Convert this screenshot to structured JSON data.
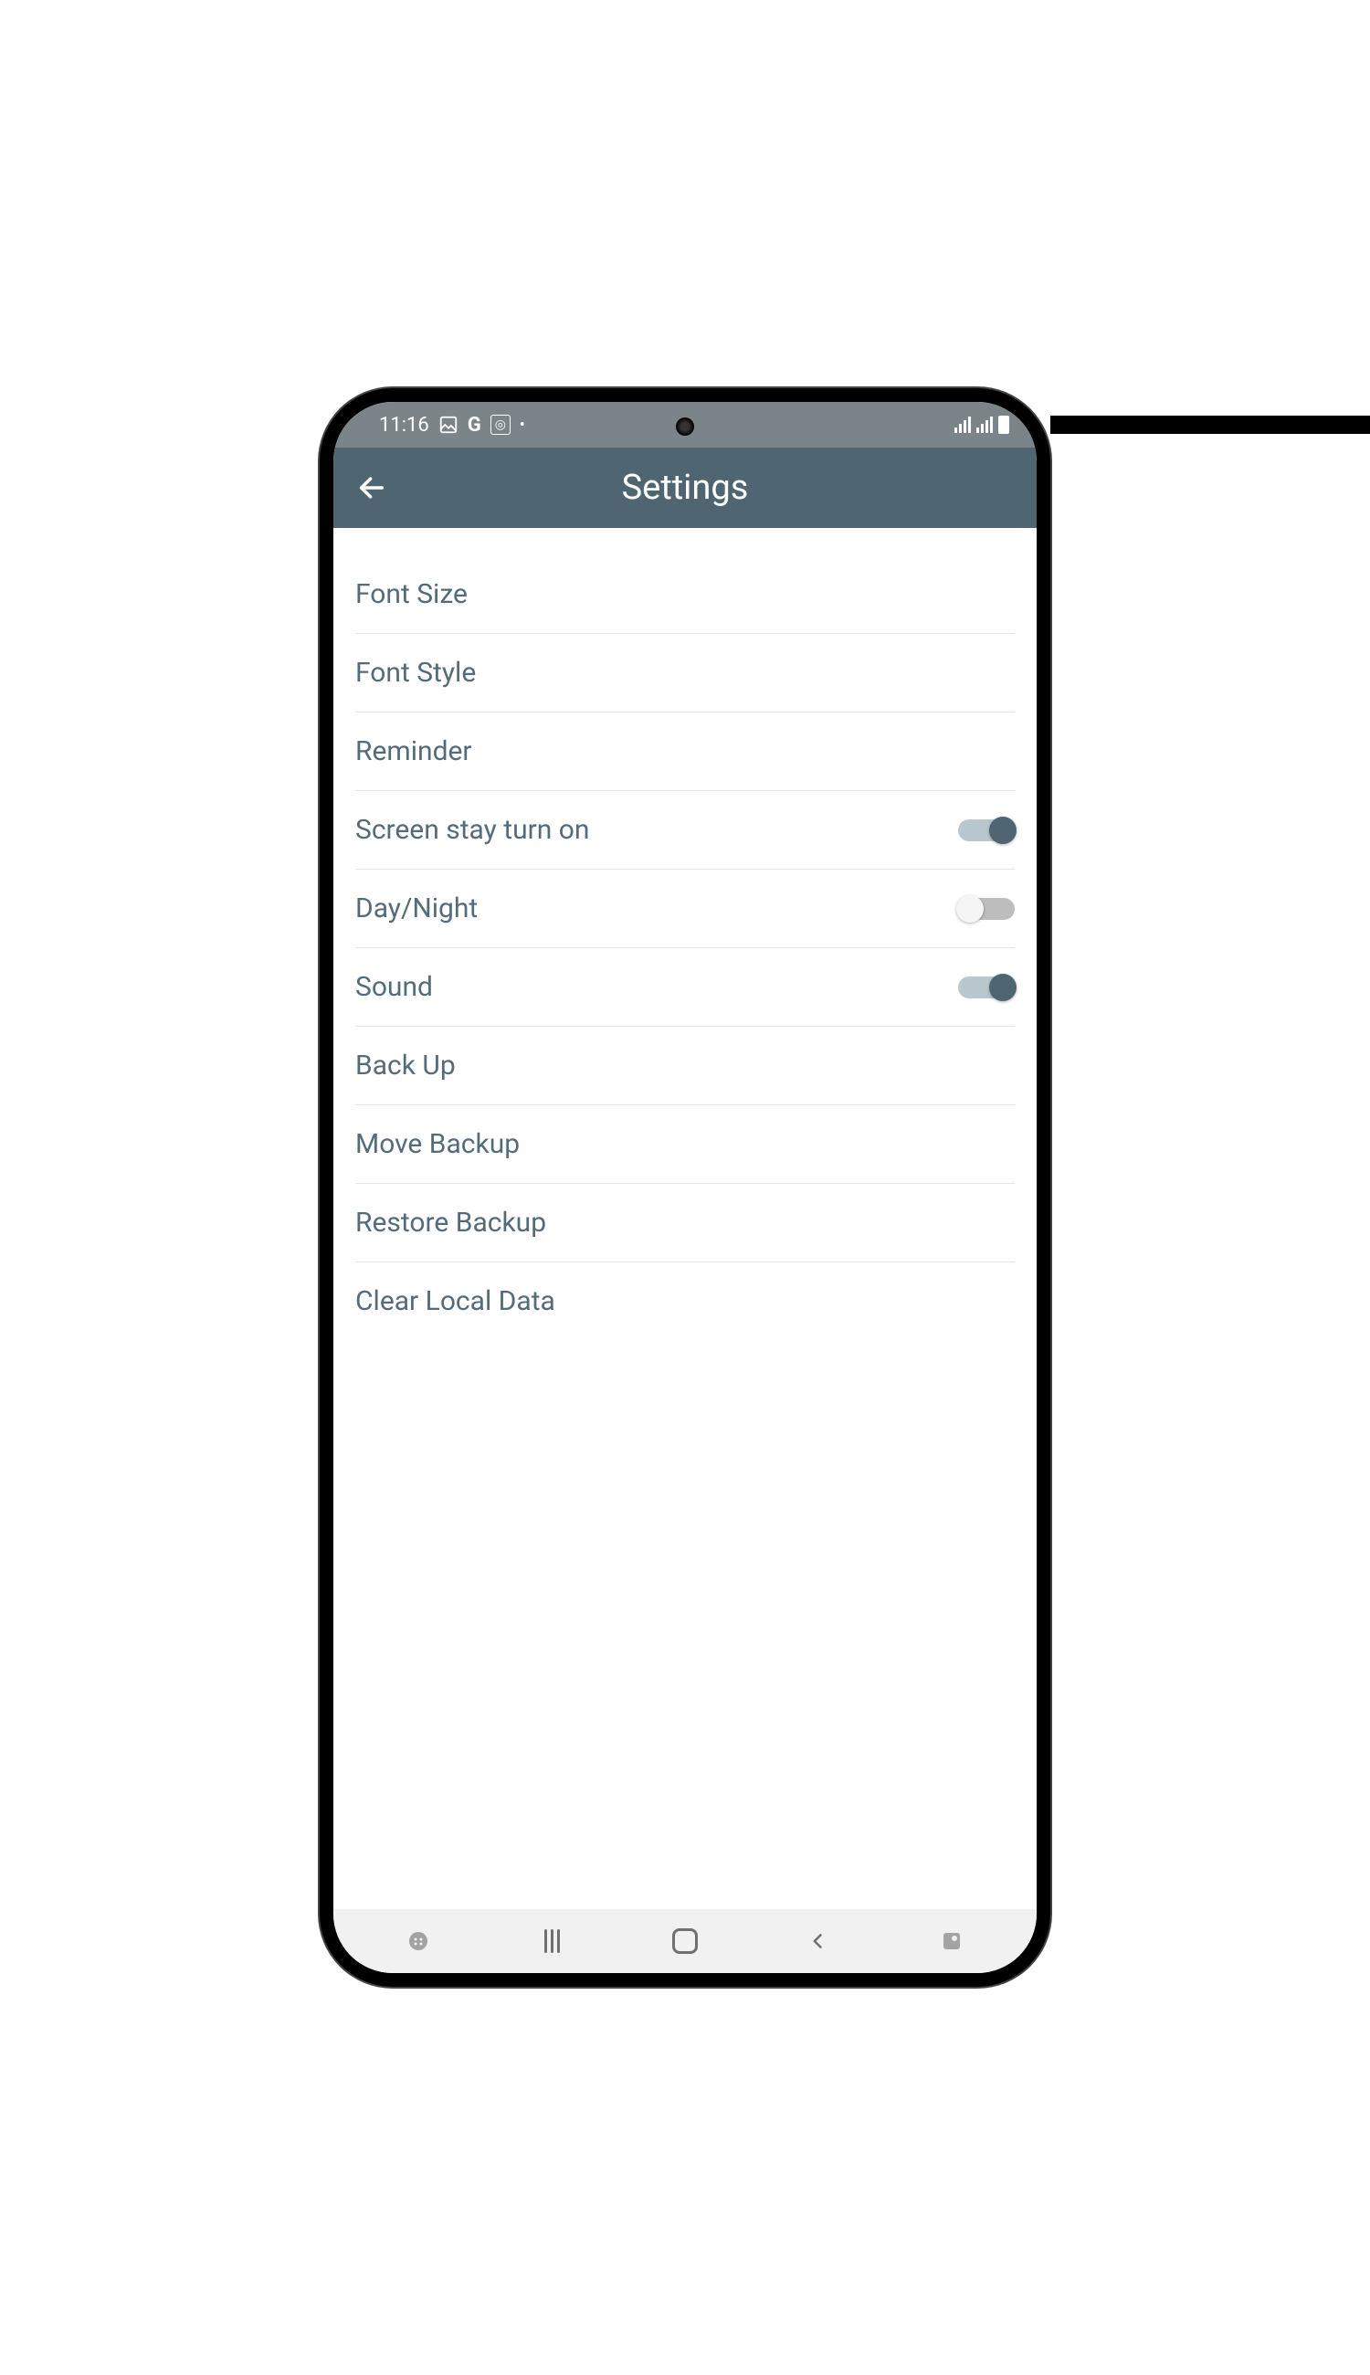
{
  "statusbar": {
    "time": "11:16",
    "icons_left": [
      "image-icon",
      "google-icon",
      "instagram-icon",
      "dot-indicator-icon"
    ],
    "icons_right": [
      "signal-icon",
      "signal-icon",
      "battery-icon"
    ]
  },
  "header": {
    "title": "Settings"
  },
  "settings_items": [
    {
      "label": "Font Size",
      "type": "link",
      "on": null
    },
    {
      "label": "Font Style",
      "type": "link",
      "on": null
    },
    {
      "label": "Reminder",
      "type": "link",
      "on": null
    },
    {
      "label": "Screen stay turn on",
      "type": "toggle",
      "on": true
    },
    {
      "label": "Day/Night",
      "type": "toggle",
      "on": false
    },
    {
      "label": "Sound",
      "type": "toggle",
      "on": true
    },
    {
      "label": "Back Up",
      "type": "link",
      "on": null
    },
    {
      "label": "Move Backup",
      "type": "link",
      "on": null
    },
    {
      "label": "Restore Backup",
      "type": "link",
      "on": null
    },
    {
      "label": "Clear Local Data",
      "type": "link",
      "on": null
    }
  ],
  "colors": {
    "header_bg": "#4f6572",
    "statusbar_bg": "#7b8489",
    "label_text": "#546b7a",
    "toggle_on_thumb": "#4f6572",
    "toggle_on_track": "#b9c8cf",
    "toggle_off_thumb": "#f5f5f5",
    "toggle_off_track": "#bdbdbd"
  }
}
